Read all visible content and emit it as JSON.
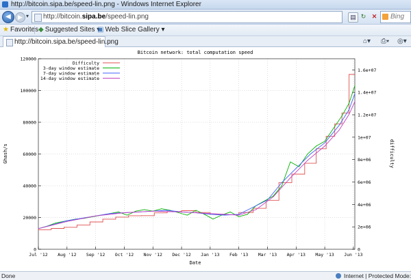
{
  "window": {
    "title": "http://bitcoin.sipa.be/speed-lin.png - Windows Internet Explorer"
  },
  "address_bar": {
    "url_prefix": "http://bitcoin.",
    "url_domain": "sipa.be",
    "url_suffix": "/speed-lin.png",
    "search_placeholder": "Bing"
  },
  "favorites_bar": {
    "favorites_label": "Favorites",
    "suggested_sites_label": "Suggested Sites",
    "web_slice_label": "Web Slice Gallery"
  },
  "tab": {
    "label": "http://bitcoin.sipa.be/speed-lin.png"
  },
  "status_bar": {
    "status": "Done",
    "zone": "Internet | Protected Mode: On"
  },
  "icons": [
    "back-icon",
    "forward-icon",
    "page-icon",
    "compatibility-icon",
    "refresh-icon",
    "stop-icon",
    "bing-icon",
    "favorites-star-icon",
    "suggested-sites-icon",
    "web-slice-icon",
    "home-icon",
    "print-icon",
    "globe-icon"
  ],
  "colors": {
    "difficulty": "#e05050",
    "est3": "#00b000",
    "est7": "#4060ff",
    "est14": "#c040c0"
  },
  "chart_data": {
    "type": "line",
    "title": "Bitcoin network: total computation speed",
    "xlabel": "Date",
    "ylabel": "Ghash/s",
    "y2label": "difficulty",
    "x_ticks": [
      "Jul '12",
      "Aug '12",
      "Sep '12",
      "Oct '12",
      "Nov '12",
      "Dec '12",
      "Jan '13",
      "Feb '13",
      "Mar '13",
      "Apr '13",
      "May '13",
      "Jun '13"
    ],
    "y_ticks": [
      "0",
      "20000",
      "40000",
      "60000",
      "80000",
      "100000",
      "120000"
    ],
    "y2_ticks": [
      "0",
      "2e+06",
      "4e+06",
      "6e+06",
      "8e+06",
      "1e+07",
      "1.2e+07",
      "1.4e+07",
      "1.6e+07"
    ],
    "ylim": [
      0,
      120000
    ],
    "y2lim": [
      0,
      17000000
    ],
    "grid": true,
    "legend_position": "top-left",
    "series": [
      {
        "name": "Difficulty",
        "type": "step",
        "x": [
          0,
          0.45,
          0.9,
          1.35,
          1.8,
          2.25,
          2.7,
          3.15,
          3.6,
          4.05,
          4.5,
          5.0,
          5.5,
          6.0,
          6.5,
          7.0,
          7.5,
          7.95,
          8.4,
          8.85,
          9.3,
          9.7,
          10.05,
          10.35,
          10.6,
          10.85
        ],
        "values": [
          1740000,
          1860000,
          1960000,
          2160000,
          2440000,
          2690000,
          2870000,
          2990000,
          3000000,
          3250000,
          3370000,
          3440000,
          3280000,
          3120000,
          3080000,
          3280000,
          3650000,
          4370000,
          5950000,
          6700000,
          7670000,
          8970000,
          10080000,
          11190000,
          12150000,
          15600000
        ]
      },
      {
        "name": "3-day window estimate",
        "x": [
          0,
          0.3,
          0.6,
          1.0,
          1.3,
          1.6,
          1.9,
          2.2,
          2.5,
          2.8,
          3.1,
          3.4,
          3.7,
          4.0,
          4.3,
          4.6,
          4.9,
          5.2,
          5.5,
          5.8,
          6.1,
          6.4,
          6.7,
          7.0,
          7.3,
          7.6,
          7.9,
          8.2,
          8.5,
          8.8,
          9.1,
          9.4,
          9.7,
          10.0,
          10.3,
          10.6,
          10.85,
          11.05
        ],
        "values": [
          13000,
          14500,
          16500,
          18000,
          19000,
          19500,
          20500,
          21500,
          22500,
          23500,
          21500,
          24000,
          25000,
          24000,
          25500,
          24500,
          23000,
          21500,
          24500,
          22000,
          19000,
          21500,
          23500,
          20500,
          22000,
          27500,
          30500,
          33500,
          40000,
          55000,
          52000,
          60000,
          65000,
          68000,
          76000,
          84000,
          92000,
          103000
        ]
      },
      {
        "name": "7-day window estimate",
        "x": [
          0,
          0.5,
          1.0,
          1.5,
          2.0,
          2.5,
          3.0,
          3.5,
          4.0,
          4.5,
          5.0,
          5.5,
          6.0,
          6.5,
          7.0,
          7.5,
          8.0,
          8.5,
          9.0,
          9.5,
          10.0,
          10.5,
          10.85,
          11.05
        ],
        "values": [
          13000,
          15500,
          18000,
          19500,
          21000,
          22500,
          23000,
          23500,
          24000,
          24500,
          23500,
          23000,
          22000,
          21500,
          22000,
          26500,
          31000,
          42000,
          51000,
          60000,
          67000,
          78000,
          88000,
          98000
        ]
      },
      {
        "name": "14-day window estimate",
        "x": [
          0,
          1.0,
          2.0,
          3.0,
          4.0,
          5.0,
          6.0,
          7.0,
          7.6,
          8.2,
          8.8,
          9.4,
          10.0,
          10.5,
          10.85,
          11.05
        ],
        "values": [
          13000,
          17500,
          21000,
          23000,
          24000,
          23500,
          22500,
          21500,
          25000,
          33000,
          45000,
          56000,
          65000,
          75000,
          85000,
          93000
        ]
      }
    ]
  }
}
